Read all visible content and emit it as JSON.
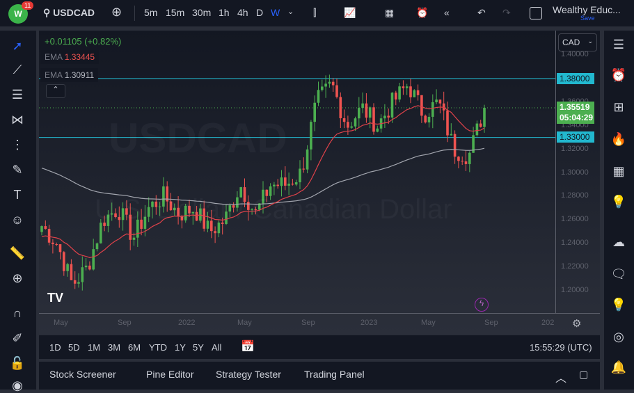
{
  "header": {
    "badge": "11",
    "logo": "W",
    "symbol": "USDCAD",
    "intervals": [
      "5m",
      "15m",
      "30m",
      "1h",
      "4h",
      "D",
      "W"
    ],
    "active_interval": "W",
    "layout_name": "Wealthy Educ...",
    "save": "Save"
  },
  "legend": {
    "change": "+0.01105 (+0.82%)",
    "ema1_label": "EMA",
    "ema1_value": "1.33445",
    "ema2_label": "EMA",
    "ema2_value": "1.30911"
  },
  "currency": "CAD",
  "watermark": {
    "ticker": "USDCAD",
    "name": "U.S. Dollar / Canadian Dollar"
  },
  "price_axis": [
    "1.40000",
    "1.36000",
    "1.34000",
    "1.32000",
    "1.30000",
    "1.28000",
    "1.26000",
    "1.24000",
    "1.22000",
    "1.20000"
  ],
  "levels": [
    {
      "value": "1.38000",
      "price": 1.38
    },
    {
      "value": "1.33000",
      "price": 1.33
    }
  ],
  "last": {
    "price": "1.35519",
    "countdown": "05:04:29",
    "value": 1.35519
  },
  "time_axis": [
    "May",
    "Sep",
    "2022",
    "May",
    "Sep",
    "2023",
    "May",
    "Sep",
    "202"
  ],
  "colors": {
    "up": "#26a69a",
    "green": "#4caf50",
    "down": "#ef5350",
    "level": "#22b8cf",
    "ema_fast": "#e0424a",
    "ema_slow": "#a3a6af"
  },
  "chart_data": {
    "type": "candlestick",
    "symbol": "USDCAD",
    "timeframe": "W",
    "ylim": [
      1.19,
      1.405
    ],
    "monthly_path": [
      1.255,
      1.24,
      1.205,
      1.22,
      1.26,
      1.27,
      1.245,
      1.27,
      1.28,
      1.265,
      1.27,
      1.25,
      1.26,
      1.29,
      1.265,
      1.29,
      1.29,
      1.3,
      1.36,
      1.375,
      1.34,
      1.355,
      1.34,
      1.36,
      1.375,
      1.35,
      1.36,
      1.32,
      1.315,
      1.355
    ]
  },
  "bottom": {
    "ranges": [
      "1D",
      "5D",
      "1M",
      "3M",
      "6M",
      "YTD",
      "1Y",
      "5Y",
      "All"
    ],
    "clock": "15:55:29 (UTC)"
  },
  "panel": {
    "tabs": [
      "Stock Screener",
      "Pine Editor",
      "Strategy Tester",
      "Trading Panel"
    ]
  }
}
